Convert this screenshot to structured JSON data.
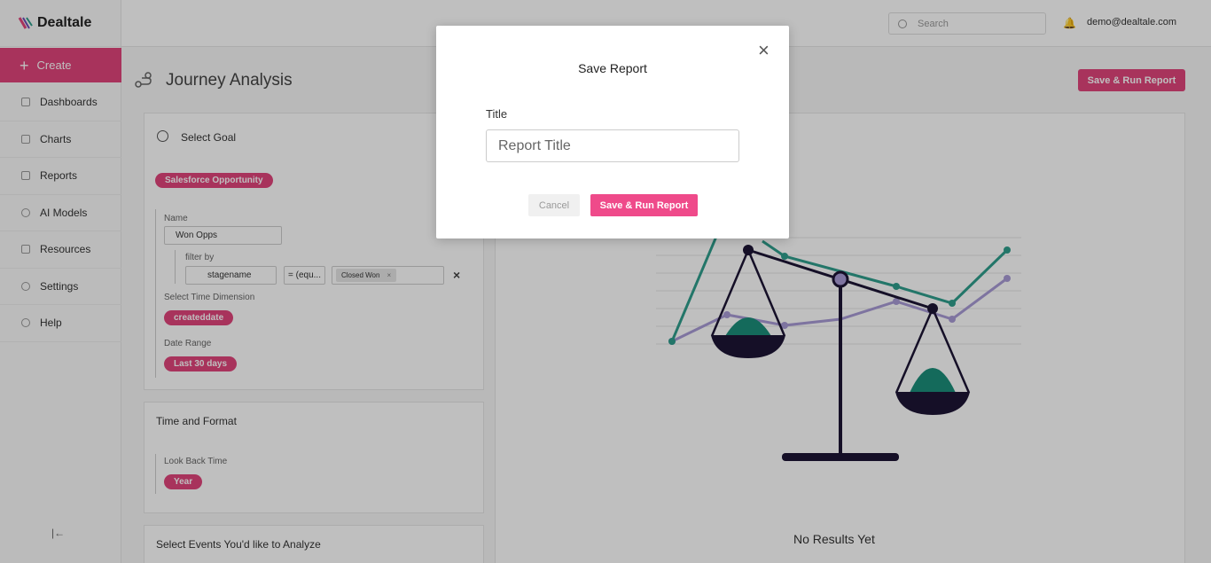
{
  "brand": {
    "name": "Dealtale"
  },
  "sidebar": {
    "create_label": "Create",
    "items": [
      {
        "label": "Dashboards",
        "icon": "dashboard-icon"
      },
      {
        "label": "Charts",
        "icon": "chart-icon"
      },
      {
        "label": "Reports",
        "icon": "report-icon"
      },
      {
        "label": "AI Models",
        "icon": "ai-icon"
      },
      {
        "label": "Resources",
        "icon": "resources-icon"
      },
      {
        "label": "Settings",
        "icon": "gear-icon"
      },
      {
        "label": "Help",
        "icon": "help-icon"
      }
    ]
  },
  "topbar": {
    "search_placeholder": "Search",
    "user_email": "demo@dealtale.com"
  },
  "page": {
    "title": "Journey Analysis",
    "run_button": "Save & Run Report"
  },
  "goal": {
    "title": "Select Goal",
    "source": "Salesforce Opportunity",
    "name_label": "Name",
    "name_value": "Won Opps",
    "filter_label": "filter by",
    "filter_field": "stagename",
    "filter_operator": "= (equ...",
    "filter_value": "Closed Won",
    "time_dimension_label": "Select Time Dimension",
    "time_dimension_value": "createddate",
    "date_range_label": "Date Range",
    "date_range_value": "Last 30 days"
  },
  "time_format": {
    "title": "Time and Format",
    "lookback_label": "Look Back Time",
    "lookback_value": "Year"
  },
  "events": {
    "title": "Select Events You'd like to Analyze"
  },
  "results": {
    "empty_text": "No Results Yet"
  },
  "modal": {
    "title": "Save Report",
    "field_label": "Title",
    "field_placeholder": "Report Title",
    "field_value": "",
    "cancel_label": "Cancel",
    "save_label": "Save & Run Report"
  },
  "colors": {
    "accent": "#e0457b",
    "modal_accent": "#ef4a8a",
    "teal": "#2f9e8c",
    "purple": "#a99bd6",
    "navy": "#1c1535"
  }
}
